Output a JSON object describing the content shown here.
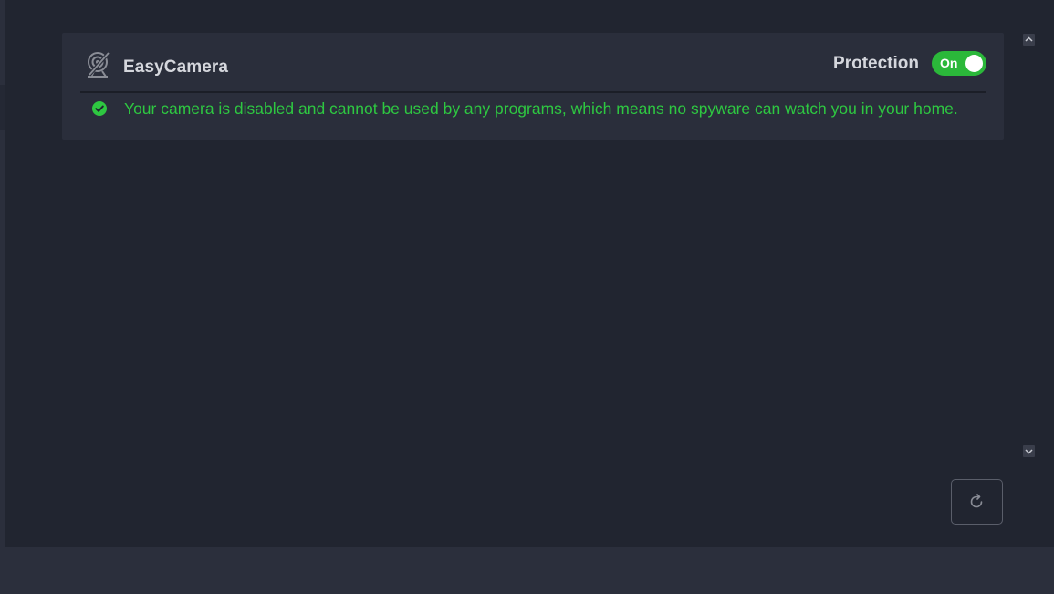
{
  "app": {
    "name": "EasyCamera",
    "icon": "webcam-icon"
  },
  "protection": {
    "label": "Protection",
    "toggle_label": "On",
    "enabled": true,
    "accent_color": "#2bb83a"
  },
  "status": {
    "icon": "check-circle-icon",
    "message": "Your camera is disabled and cannot be used by any programs, which means no spyware can watch you in your home.",
    "color": "#2ec741"
  },
  "controls": {
    "scroll_up_icon": "chevron-up-icon",
    "scroll_down_icon": "chevron-down-icon",
    "refresh_icon": "refresh-icon"
  }
}
